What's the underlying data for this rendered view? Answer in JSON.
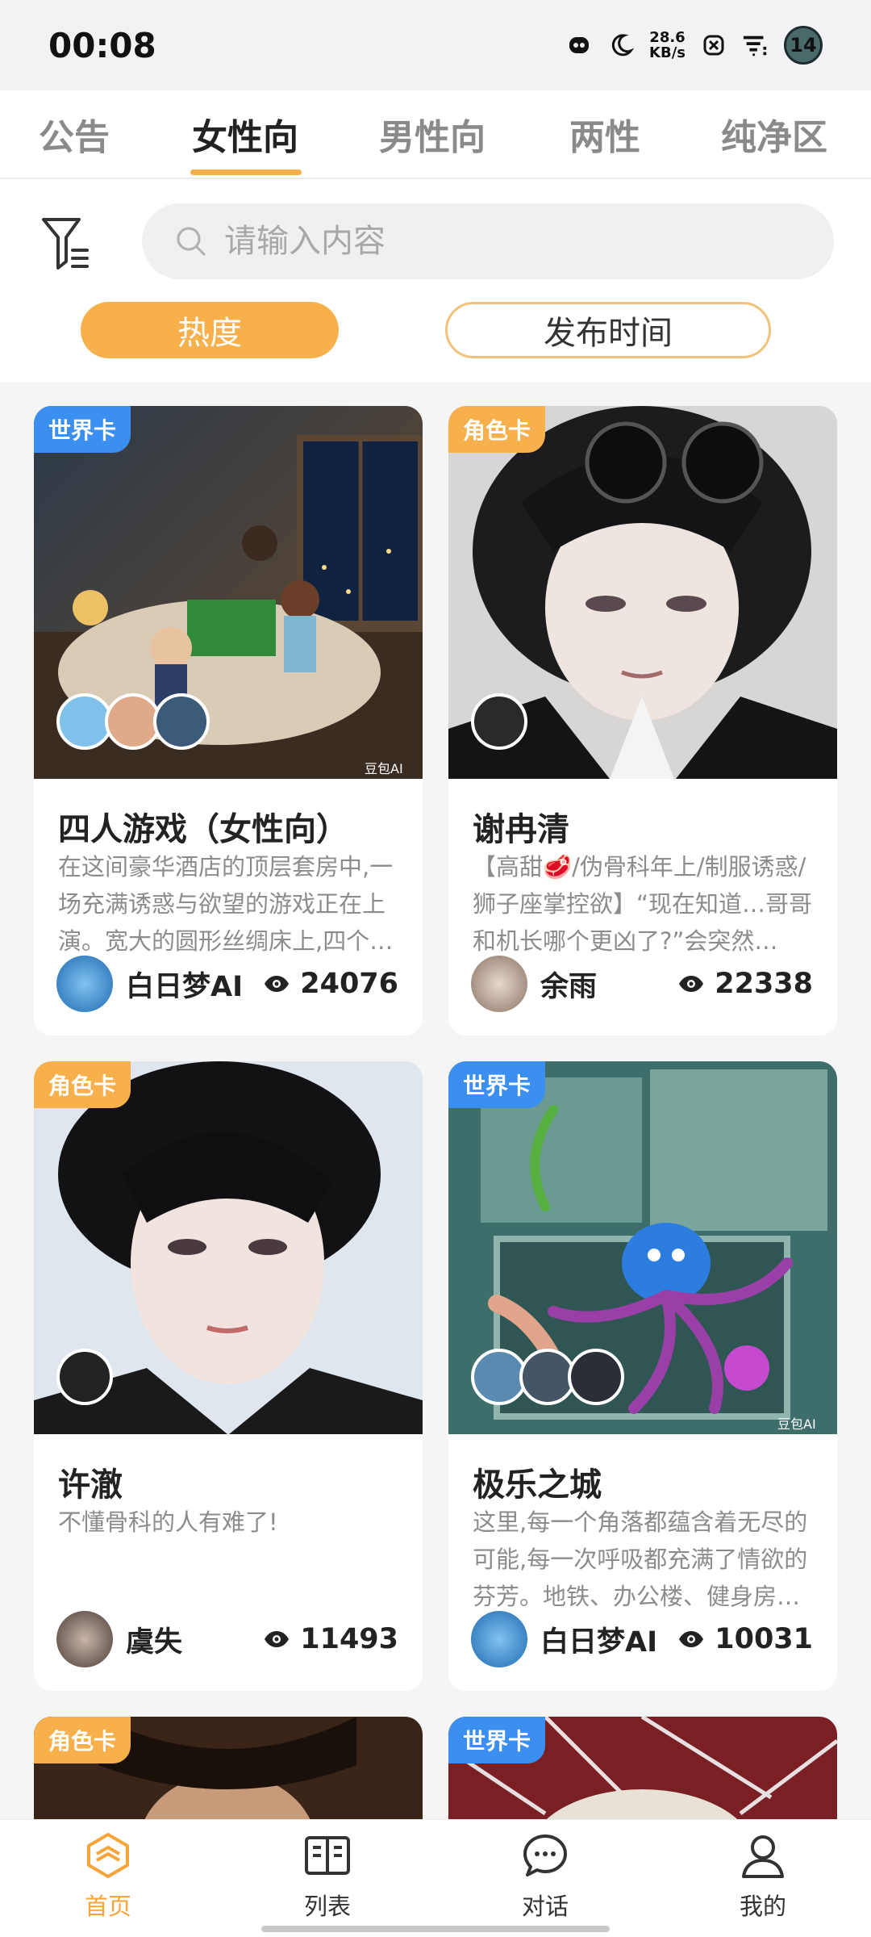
{
  "status_bar": {
    "time": "00:08",
    "net_speed_value": "28.6",
    "net_speed_unit": "KB/s",
    "battery": "14"
  },
  "tabs": [
    {
      "label": "公告"
    },
    {
      "label": "女性向",
      "active": true
    },
    {
      "label": "男性向"
    },
    {
      "label": "两性"
    },
    {
      "label": "纯净区"
    }
  ],
  "search": {
    "placeholder": "请输入内容",
    "value": ""
  },
  "sort": {
    "hot": "热度",
    "time": "发布时间",
    "selected": "热度"
  },
  "badge_labels": {
    "world": "世界卡",
    "role": "角色卡"
  },
  "cards": [
    {
      "type": "世界卡",
      "title": "四人游戏（女性向）",
      "desc": "在这间豪华酒店的顶层套房中,一场充满诱惑与欲望的游戏正在上演。宽大的圆形丝绸床上,四个…",
      "author": "白日梦AI",
      "views": "24076",
      "image_watermark": "豆包AI"
    },
    {
      "type": "角色卡",
      "title": "谢冉清",
      "desc": "【高甜🥩/伪骨科年上/制服诱惑/狮子座掌控欲】“现在知道…哥哥和机长哪个更凶了?”会突然…",
      "author": "余雨",
      "views": "22338"
    },
    {
      "type": "角色卡",
      "title": "许澈",
      "desc": "不懂骨科的人有难了!",
      "author": "虞失",
      "views": "11493"
    },
    {
      "type": "世界卡",
      "title": "极乐之城",
      "desc": "这里,每一个角落都蕴含着无尽的可能,每一次呼吸都充满了情欲的芬芳。地铁、办公楼、健身房…",
      "author": "白日梦AI",
      "views": "10031",
      "image_watermark": "豆包AI"
    },
    {
      "type": "角色卡"
    },
    {
      "type": "世界卡"
    }
  ],
  "bottom_nav": [
    {
      "label": "首页",
      "icon": "home-icon",
      "active": true
    },
    {
      "label": "列表",
      "icon": "book-icon"
    },
    {
      "label": "对话",
      "icon": "chat-icon"
    },
    {
      "label": "我的",
      "icon": "profile-icon"
    }
  ],
  "colors": {
    "accent": "#f7b04c",
    "world_badge": "#3b8ff0",
    "role_badge": "#f7b04c"
  }
}
